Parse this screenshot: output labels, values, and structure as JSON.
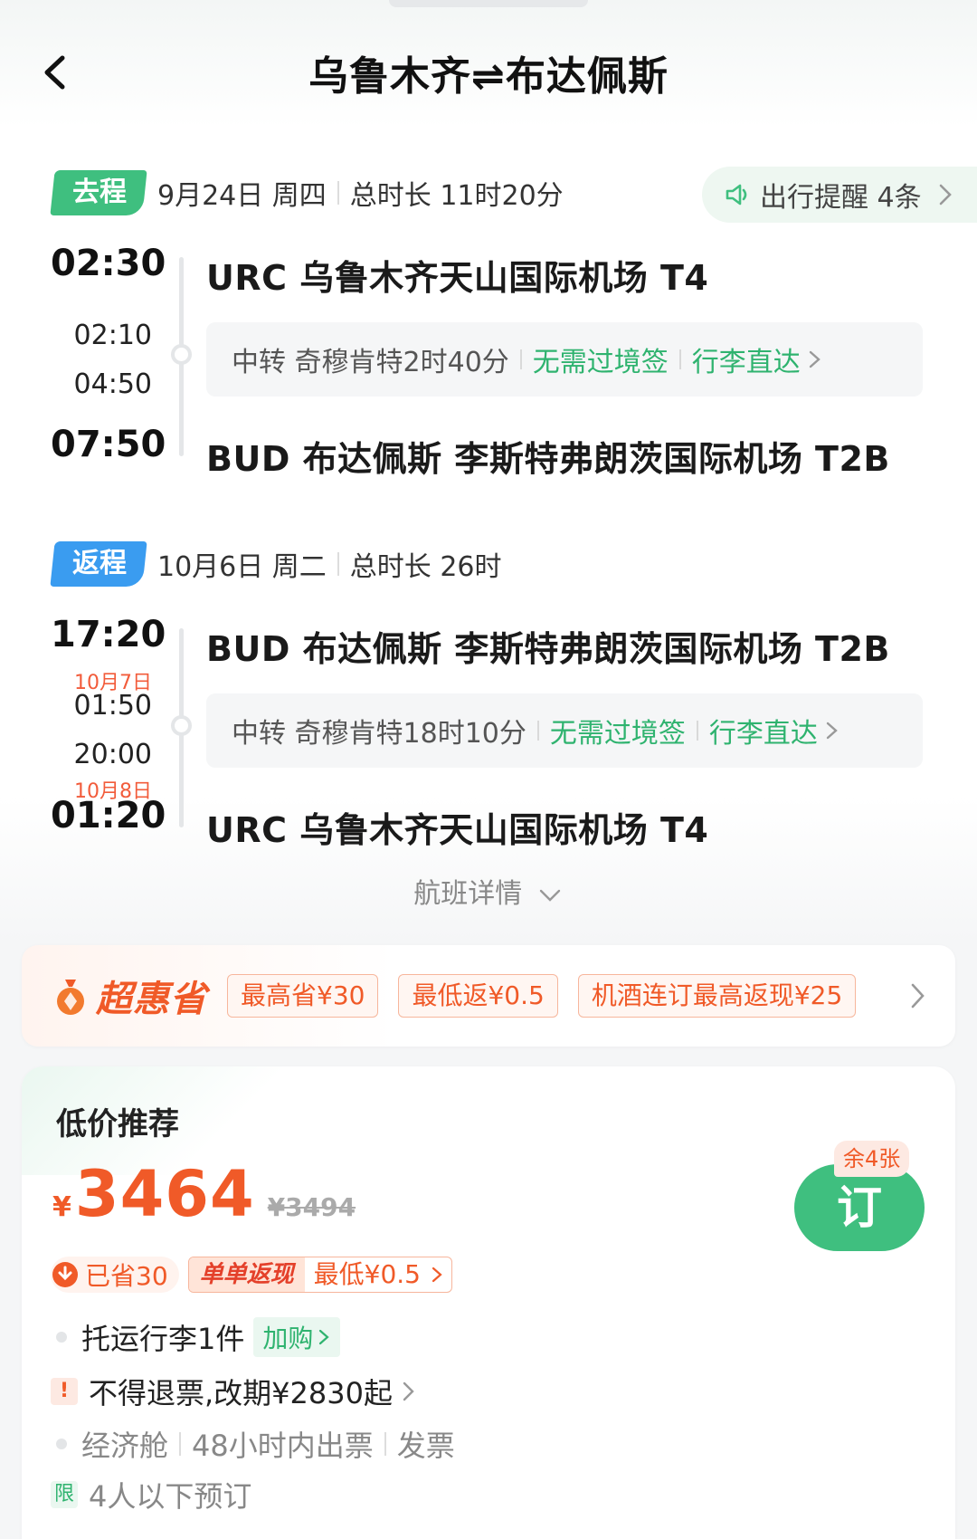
{
  "header": {
    "title": "乌鲁木齐⇌布达佩斯"
  },
  "reminder": {
    "label": "出行提醒 4条"
  },
  "outbound": {
    "tag": "去程",
    "date": "9月24日 周四",
    "duration": "总时长 11时20分",
    "depart_time": "02:30",
    "depart_airport": "URC 乌鲁木齐天山国际机场 T4",
    "transfer_arrive": "02:10",
    "transfer_depart": "04:50",
    "transfer_info": "中转 奇穆肯特2时40分",
    "visa": "无需过境签",
    "baggage": "行李直达",
    "arrive_time": "07:50",
    "arrive_airport": "BUD 布达佩斯 李斯特弗朗茨国际机场 T2B"
  },
  "return": {
    "tag": "返程",
    "date": "10月6日 周二",
    "duration": "总时长 26时",
    "depart_time": "17:20",
    "depart_airport": "BUD 布达佩斯 李斯特弗朗茨国际机场 T2B",
    "transfer_arrive_date": "10月7日",
    "transfer_arrive": "01:50",
    "transfer_depart": "20:00",
    "transfer_info": "中转 奇穆肯特18时10分",
    "visa": "无需过境签",
    "baggage": "行李直达",
    "arrive_date": "10月8日",
    "arrive_time": "01:20",
    "arrive_airport": "URC 乌鲁木齐天山国际机场 T4"
  },
  "flight_detail": "航班详情",
  "promo": {
    "brand": "超惠省",
    "chips": [
      "最高省¥30",
      "最低返¥0.5",
      "机酒连订最高返现¥25"
    ]
  },
  "offer": {
    "section_title": "低价推荐",
    "currency": "¥",
    "price": "3464",
    "original_price": "¥3494",
    "remaining": "余4张",
    "book_label": "订",
    "saved": "已省30",
    "cashback_tag": "单单返现",
    "cashback_value": "最低¥0.5",
    "baggage": "托运行李1件",
    "add_label": "加购",
    "refund": "不得退票,改期¥2830起",
    "cabin": "经济舱",
    "ticketing": "48小时内出票",
    "invoice": "发票",
    "limit_tag": "限",
    "limit_text": "4人以下预订"
  },
  "colors": {
    "green": "#3fbf7f",
    "blue": "#3a9cf0",
    "orange": "#f05a28"
  }
}
